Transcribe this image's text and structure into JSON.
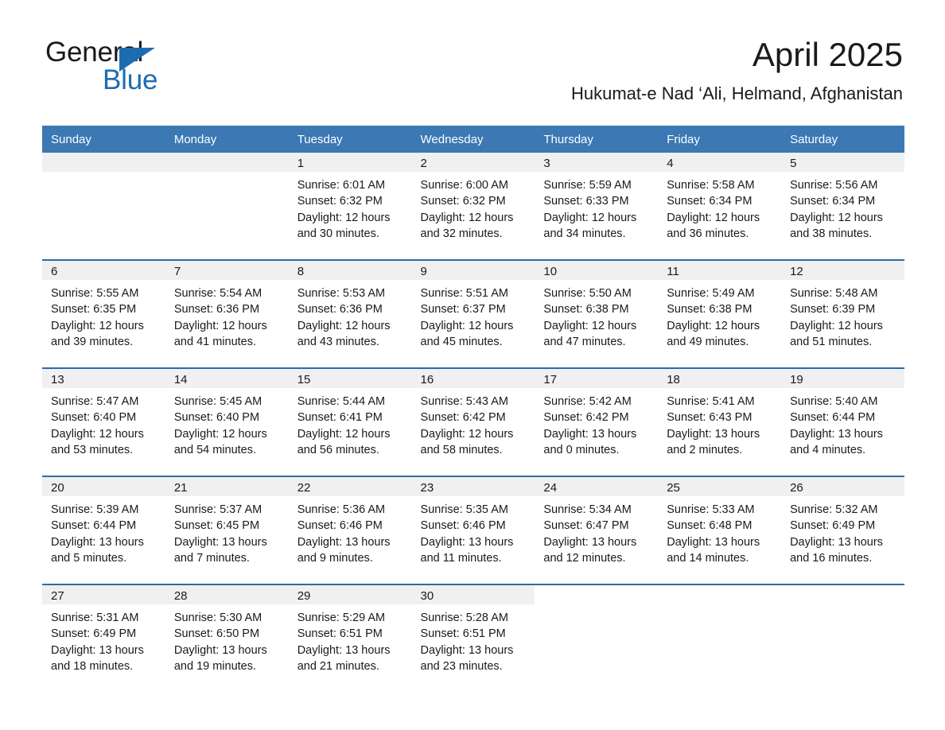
{
  "brand": {
    "name_part1": "General",
    "name_part2": "Blue",
    "accent_color": "#1e6cb0"
  },
  "header": {
    "month_title": "April 2025",
    "location": "Hukumat-e Nad ‘Ali, Helmand, Afghanistan"
  },
  "calendar": {
    "header_bg": "#3b78b4",
    "row_rule_color": "#2e6ca8",
    "daynum_band_bg": "#f0f0f0",
    "weekday_headers": [
      "Sunday",
      "Monday",
      "Tuesday",
      "Wednesday",
      "Thursday",
      "Friday",
      "Saturday"
    ],
    "weeks": [
      [
        {
          "day": "",
          "sunrise": "",
          "sunset": "",
          "daylight_line1": "",
          "daylight_line2": "",
          "empty": true
        },
        {
          "day": "",
          "sunrise": "",
          "sunset": "",
          "daylight_line1": "",
          "daylight_line2": "",
          "empty": true
        },
        {
          "day": "1",
          "sunrise": "Sunrise: 6:01 AM",
          "sunset": "Sunset: 6:32 PM",
          "daylight_line1": "Daylight: 12 hours",
          "daylight_line2": "and 30 minutes."
        },
        {
          "day": "2",
          "sunrise": "Sunrise: 6:00 AM",
          "sunset": "Sunset: 6:32 PM",
          "daylight_line1": "Daylight: 12 hours",
          "daylight_line2": "and 32 minutes."
        },
        {
          "day": "3",
          "sunrise": "Sunrise: 5:59 AM",
          "sunset": "Sunset: 6:33 PM",
          "daylight_line1": "Daylight: 12 hours",
          "daylight_line2": "and 34 minutes."
        },
        {
          "day": "4",
          "sunrise": "Sunrise: 5:58 AM",
          "sunset": "Sunset: 6:34 PM",
          "daylight_line1": "Daylight: 12 hours",
          "daylight_line2": "and 36 minutes."
        },
        {
          "day": "5",
          "sunrise": "Sunrise: 5:56 AM",
          "sunset": "Sunset: 6:34 PM",
          "daylight_line1": "Daylight: 12 hours",
          "daylight_line2": "and 38 minutes."
        }
      ],
      [
        {
          "day": "6",
          "sunrise": "Sunrise: 5:55 AM",
          "sunset": "Sunset: 6:35 PM",
          "daylight_line1": "Daylight: 12 hours",
          "daylight_line2": "and 39 minutes."
        },
        {
          "day": "7",
          "sunrise": "Sunrise: 5:54 AM",
          "sunset": "Sunset: 6:36 PM",
          "daylight_line1": "Daylight: 12 hours",
          "daylight_line2": "and 41 minutes."
        },
        {
          "day": "8",
          "sunrise": "Sunrise: 5:53 AM",
          "sunset": "Sunset: 6:36 PM",
          "daylight_line1": "Daylight: 12 hours",
          "daylight_line2": "and 43 minutes."
        },
        {
          "day": "9",
          "sunrise": "Sunrise: 5:51 AM",
          "sunset": "Sunset: 6:37 PM",
          "daylight_line1": "Daylight: 12 hours",
          "daylight_line2": "and 45 minutes."
        },
        {
          "day": "10",
          "sunrise": "Sunrise: 5:50 AM",
          "sunset": "Sunset: 6:38 PM",
          "daylight_line1": "Daylight: 12 hours",
          "daylight_line2": "and 47 minutes."
        },
        {
          "day": "11",
          "sunrise": "Sunrise: 5:49 AM",
          "sunset": "Sunset: 6:38 PM",
          "daylight_line1": "Daylight: 12 hours",
          "daylight_line2": "and 49 minutes."
        },
        {
          "day": "12",
          "sunrise": "Sunrise: 5:48 AM",
          "sunset": "Sunset: 6:39 PM",
          "daylight_line1": "Daylight: 12 hours",
          "daylight_line2": "and 51 minutes."
        }
      ],
      [
        {
          "day": "13",
          "sunrise": "Sunrise: 5:47 AM",
          "sunset": "Sunset: 6:40 PM",
          "daylight_line1": "Daylight: 12 hours",
          "daylight_line2": "and 53 minutes."
        },
        {
          "day": "14",
          "sunrise": "Sunrise: 5:45 AM",
          "sunset": "Sunset: 6:40 PM",
          "daylight_line1": "Daylight: 12 hours",
          "daylight_line2": "and 54 minutes."
        },
        {
          "day": "15",
          "sunrise": "Sunrise: 5:44 AM",
          "sunset": "Sunset: 6:41 PM",
          "daylight_line1": "Daylight: 12 hours",
          "daylight_line2": "and 56 minutes."
        },
        {
          "day": "16",
          "sunrise": "Sunrise: 5:43 AM",
          "sunset": "Sunset: 6:42 PM",
          "daylight_line1": "Daylight: 12 hours",
          "daylight_line2": "and 58 minutes."
        },
        {
          "day": "17",
          "sunrise": "Sunrise: 5:42 AM",
          "sunset": "Sunset: 6:42 PM",
          "daylight_line1": "Daylight: 13 hours",
          "daylight_line2": "and 0 minutes."
        },
        {
          "day": "18",
          "sunrise": "Sunrise: 5:41 AM",
          "sunset": "Sunset: 6:43 PM",
          "daylight_line1": "Daylight: 13 hours",
          "daylight_line2": "and 2 minutes."
        },
        {
          "day": "19",
          "sunrise": "Sunrise: 5:40 AM",
          "sunset": "Sunset: 6:44 PM",
          "daylight_line1": "Daylight: 13 hours",
          "daylight_line2": "and 4 minutes."
        }
      ],
      [
        {
          "day": "20",
          "sunrise": "Sunrise: 5:39 AM",
          "sunset": "Sunset: 6:44 PM",
          "daylight_line1": "Daylight: 13 hours",
          "daylight_line2": "and 5 minutes."
        },
        {
          "day": "21",
          "sunrise": "Sunrise: 5:37 AM",
          "sunset": "Sunset: 6:45 PM",
          "daylight_line1": "Daylight: 13 hours",
          "daylight_line2": "and 7 minutes."
        },
        {
          "day": "22",
          "sunrise": "Sunrise: 5:36 AM",
          "sunset": "Sunset: 6:46 PM",
          "daylight_line1": "Daylight: 13 hours",
          "daylight_line2": "and 9 minutes."
        },
        {
          "day": "23",
          "sunrise": "Sunrise: 5:35 AM",
          "sunset": "Sunset: 6:46 PM",
          "daylight_line1": "Daylight: 13 hours",
          "daylight_line2": "and 11 minutes."
        },
        {
          "day": "24",
          "sunrise": "Sunrise: 5:34 AM",
          "sunset": "Sunset: 6:47 PM",
          "daylight_line1": "Daylight: 13 hours",
          "daylight_line2": "and 12 minutes."
        },
        {
          "day": "25",
          "sunrise": "Sunrise: 5:33 AM",
          "sunset": "Sunset: 6:48 PM",
          "daylight_line1": "Daylight: 13 hours",
          "daylight_line2": "and 14 minutes."
        },
        {
          "day": "26",
          "sunrise": "Sunrise: 5:32 AM",
          "sunset": "Sunset: 6:49 PM",
          "daylight_line1": "Daylight: 13 hours",
          "daylight_line2": "and 16 minutes."
        }
      ],
      [
        {
          "day": "27",
          "sunrise": "Sunrise: 5:31 AM",
          "sunset": "Sunset: 6:49 PM",
          "daylight_line1": "Daylight: 13 hours",
          "daylight_line2": "and 18 minutes."
        },
        {
          "day": "28",
          "sunrise": "Sunrise: 5:30 AM",
          "sunset": "Sunset: 6:50 PM",
          "daylight_line1": "Daylight: 13 hours",
          "daylight_line2": "and 19 minutes."
        },
        {
          "day": "29",
          "sunrise": "Sunrise: 5:29 AM",
          "sunset": "Sunset: 6:51 PM",
          "daylight_line1": "Daylight: 13 hours",
          "daylight_line2": "and 21 minutes."
        },
        {
          "day": "30",
          "sunrise": "Sunrise: 5:28 AM",
          "sunset": "Sunset: 6:51 PM",
          "daylight_line1": "Daylight: 13 hours",
          "daylight_line2": "and 23 minutes."
        },
        {
          "day": "",
          "sunrise": "",
          "sunset": "",
          "daylight_line1": "",
          "daylight_line2": "",
          "blank": true
        },
        {
          "day": "",
          "sunrise": "",
          "sunset": "",
          "daylight_line1": "",
          "daylight_line2": "",
          "blank": true
        },
        {
          "day": "",
          "sunrise": "",
          "sunset": "",
          "daylight_line1": "",
          "daylight_line2": "",
          "blank": true
        }
      ]
    ]
  }
}
